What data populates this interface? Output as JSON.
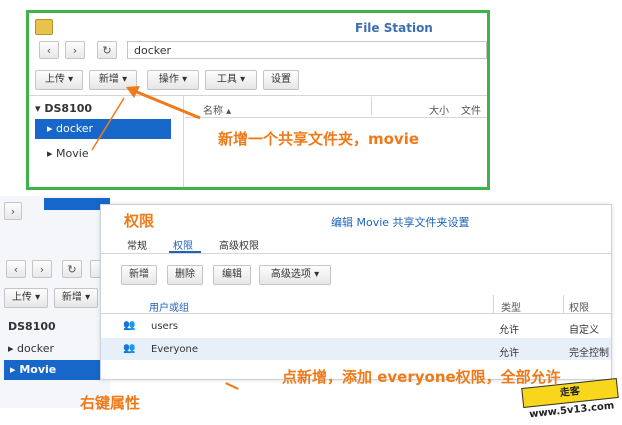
{
  "top_window": {
    "title": "File Station",
    "path": "docker",
    "toolbar": {
      "upload": "上传 ▾",
      "new": "新增 ▾",
      "action": "操作 ▾",
      "tools": "工具 ▾",
      "settings": "设置"
    },
    "tree": {
      "root": "DS8100",
      "items": [
        "docker",
        "Movie"
      ]
    },
    "columns": {
      "name": "名称 ▴",
      "size": "大小",
      "type": "文件"
    }
  },
  "annotations": {
    "create_folder": "新增一个共享文件夹，movie",
    "permissions": "权限",
    "right_click": "右键属性",
    "add_everyone": "点新增，添加 everyone权限，全部允许"
  },
  "bg_window": {
    "upload": "上传 ▾",
    "new": "新增 ▾",
    "tree": {
      "root": "DS8100",
      "items": [
        "docker",
        "Movie"
      ]
    }
  },
  "dialog": {
    "title": "编辑 Movie 共享文件夹设置",
    "tabs": [
      "常规",
      "权限",
      "高级权限"
    ],
    "toolbar": {
      "add": "新增",
      "delete": "删除",
      "edit": "编辑",
      "advanced": "高级选项 ▾"
    },
    "columns": {
      "user": "用户或组",
      "type": "类型",
      "permission": "权限"
    },
    "rows": [
      {
        "user": "users",
        "type": "允许",
        "permission": "自定义"
      },
      {
        "user": "Everyone",
        "type": "允许",
        "permission": "完全控制"
      }
    ]
  },
  "watermark": "走客 www.5v13.com",
  "colors": {
    "accent_green": "#3db34a",
    "selection_blue": "#1667c9",
    "annotation_orange": "#f07a1a",
    "title_blue": "#3a6fb0"
  },
  "icons": [
    "file-station-icon",
    "back-icon",
    "forward-icon",
    "refresh-icon",
    "user-group-icon"
  ]
}
